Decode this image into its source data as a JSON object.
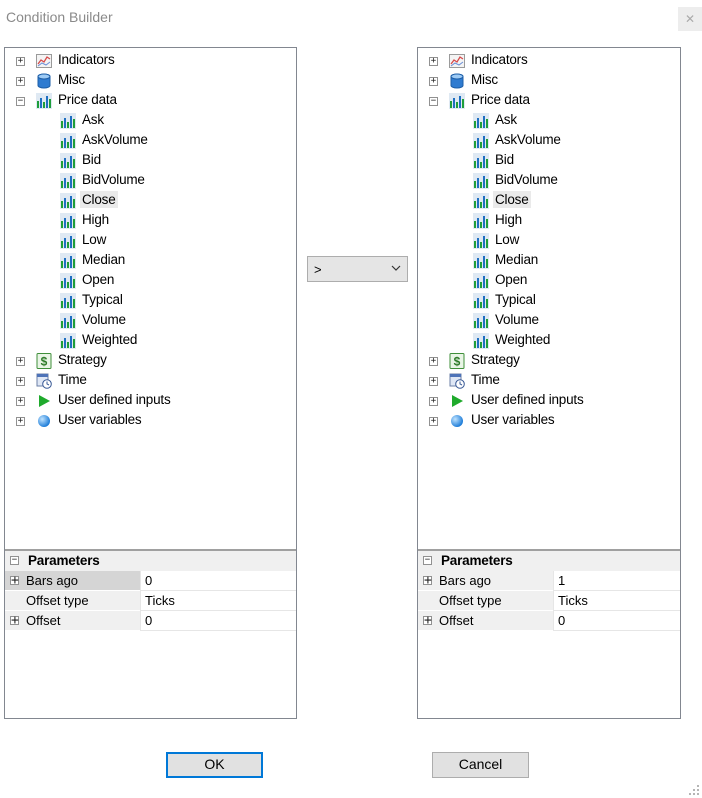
{
  "window": {
    "title": "Condition Builder",
    "close_glyph": "✕"
  },
  "operator": {
    "value": ">",
    "icon": "chevron-down-icon"
  },
  "left_tree": {
    "selected": "Close",
    "nodes": [
      {
        "label": "Indicators",
        "icon": "indicator-chart-icon",
        "expander": "+",
        "level": 0
      },
      {
        "label": "Misc",
        "icon": "database-icon",
        "expander": "+",
        "level": 0
      },
      {
        "label": "Price data",
        "icon": "bar-chart-icon",
        "expander": "−",
        "level": 0
      },
      {
        "label": "Ask",
        "icon": "bar-chart-icon",
        "level": 1
      },
      {
        "label": "AskVolume",
        "icon": "bar-chart-icon",
        "level": 1
      },
      {
        "label": "Bid",
        "icon": "bar-chart-icon",
        "level": 1
      },
      {
        "label": "BidVolume",
        "icon": "bar-chart-icon",
        "level": 1
      },
      {
        "label": "Close",
        "icon": "bar-chart-icon",
        "level": 1
      },
      {
        "label": "High",
        "icon": "bar-chart-icon",
        "level": 1
      },
      {
        "label": "Low",
        "icon": "bar-chart-icon",
        "level": 1
      },
      {
        "label": "Median",
        "icon": "bar-chart-icon",
        "level": 1
      },
      {
        "label": "Open",
        "icon": "bar-chart-icon",
        "level": 1
      },
      {
        "label": "Typical",
        "icon": "bar-chart-icon",
        "level": 1
      },
      {
        "label": "Volume",
        "icon": "bar-chart-icon",
        "level": 1
      },
      {
        "label": "Weighted",
        "icon": "bar-chart-icon",
        "level": 1
      },
      {
        "label": "Strategy",
        "icon": "dollar-icon",
        "expander": "+",
        "level": 0
      },
      {
        "label": "Time",
        "icon": "calendar-clock-icon",
        "expander": "+",
        "level": 0
      },
      {
        "label": "User defined inputs",
        "icon": "play-icon",
        "expander": "+",
        "level": 0
      },
      {
        "label": "User variables",
        "icon": "sphere-icon",
        "expander": "+",
        "level": 0
      }
    ]
  },
  "right_tree": {
    "selected": "Close",
    "nodes": [
      {
        "label": "Indicators",
        "icon": "indicator-chart-icon",
        "expander": "+",
        "level": 0
      },
      {
        "label": "Misc",
        "icon": "database-icon",
        "expander": "+",
        "level": 0
      },
      {
        "label": "Price data",
        "icon": "bar-chart-icon",
        "expander": "−",
        "level": 0
      },
      {
        "label": "Ask",
        "icon": "bar-chart-icon",
        "level": 1
      },
      {
        "label": "AskVolume",
        "icon": "bar-chart-icon",
        "level": 1
      },
      {
        "label": "Bid",
        "icon": "bar-chart-icon",
        "level": 1
      },
      {
        "label": "BidVolume",
        "icon": "bar-chart-icon",
        "level": 1
      },
      {
        "label": "Close",
        "icon": "bar-chart-icon",
        "level": 1
      },
      {
        "label": "High",
        "icon": "bar-chart-icon",
        "level": 1
      },
      {
        "label": "Low",
        "icon": "bar-chart-icon",
        "level": 1
      },
      {
        "label": "Median",
        "icon": "bar-chart-icon",
        "level": 1
      },
      {
        "label": "Open",
        "icon": "bar-chart-icon",
        "level": 1
      },
      {
        "label": "Typical",
        "icon": "bar-chart-icon",
        "level": 1
      },
      {
        "label": "Volume",
        "icon": "bar-chart-icon",
        "level": 1
      },
      {
        "label": "Weighted",
        "icon": "bar-chart-icon",
        "level": 1
      },
      {
        "label": "Strategy",
        "icon": "dollar-icon",
        "expander": "+",
        "level": 0
      },
      {
        "label": "Time",
        "icon": "calendar-clock-icon",
        "expander": "+",
        "level": 0
      },
      {
        "label": "User defined inputs",
        "icon": "play-icon",
        "expander": "+",
        "level": 0
      },
      {
        "label": "User variables",
        "icon": "sphere-icon",
        "expander": "+",
        "level": 0
      }
    ]
  },
  "left_params": {
    "header": "Parameters",
    "header_expander": "−",
    "rows": [
      {
        "name": "Bars ago",
        "value": "0",
        "expander": "+"
      },
      {
        "name": "Offset type",
        "value": "Ticks",
        "expander": ""
      },
      {
        "name": "Offset",
        "value": "0",
        "expander": "+"
      }
    ]
  },
  "right_params": {
    "header": "Parameters",
    "header_expander": "−",
    "rows": [
      {
        "name": "Bars ago",
        "value": "1",
        "expander": "+"
      },
      {
        "name": "Offset type",
        "value": "Ticks",
        "expander": ""
      },
      {
        "name": "Offset",
        "value": "0",
        "expander": "+"
      }
    ]
  },
  "buttons": {
    "ok": "OK",
    "cancel": "Cancel"
  },
  "colors": {
    "accent": "#0078d7",
    "bar_green": "#1e9e3a",
    "bar_blue": "#1f6fc1"
  }
}
